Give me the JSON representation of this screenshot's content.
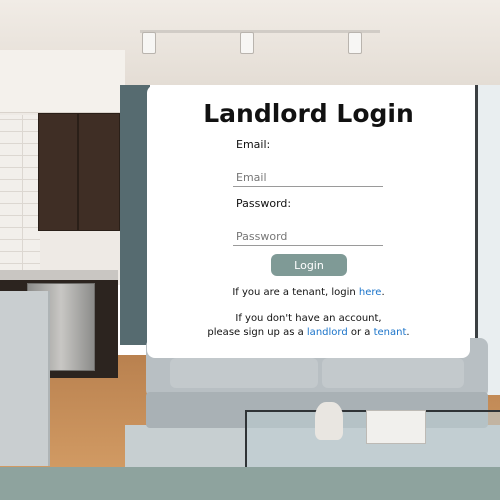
{
  "login": {
    "title": "Landlord Login",
    "email_label": "Email:",
    "email_placeholder": "Email",
    "email_value": "",
    "password_label": "Password:",
    "password_placeholder": "Password",
    "password_value": "",
    "login_button": "Login",
    "tenant_prefix": "If you are a tenant, login ",
    "tenant_link": "here",
    "tenant_suffix": ".",
    "signup_line1": "If you don't have an account,",
    "signup_prefix": "please sign up as a ",
    "signup_landlord_link": "landlord",
    "signup_or": " or a ",
    "signup_tenant_link": "tenant",
    "signup_suffix": "."
  },
  "colors": {
    "button": "#7f9a96",
    "link": "#1a73c9",
    "card": "#ffffff"
  }
}
